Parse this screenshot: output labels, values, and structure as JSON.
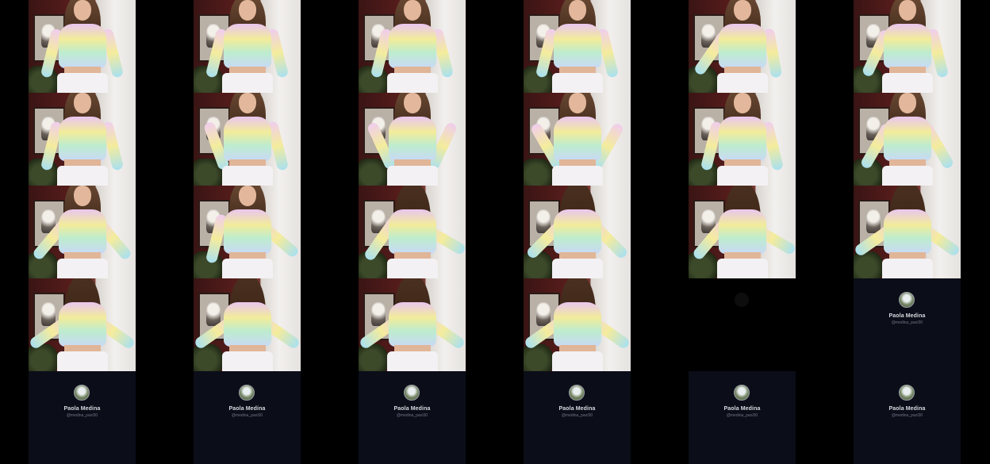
{
  "profile": {
    "name": "Paola Medina",
    "handle": "@medina_paol30"
  },
  "layout_grid": {
    "columns": 6,
    "rows": 5,
    "description_free": true
  },
  "colors": {
    "background": "#000000",
    "endcard_background": "#0b0d18"
  }
}
